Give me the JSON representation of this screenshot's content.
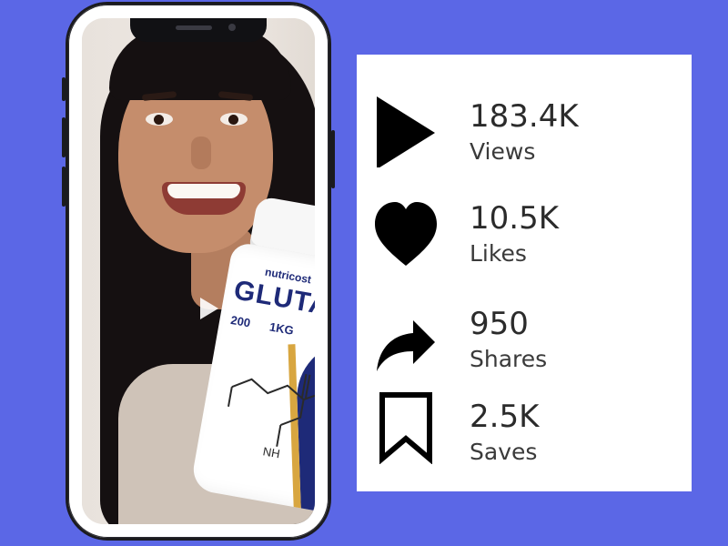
{
  "video": {
    "product": {
      "brand": "nutricost",
      "name": "GLUTAMINE",
      "meta_1": "200",
      "meta_2": "1KG",
      "amine_label": "NH"
    }
  },
  "stats": [
    {
      "icon": "play-icon",
      "value": "183.4K",
      "label": "Views"
    },
    {
      "icon": "heart-icon",
      "value": "10.5K",
      "label": "Likes"
    },
    {
      "icon": "share-icon",
      "value": "950",
      "label": "Shares"
    },
    {
      "icon": "bookmark-icon",
      "value": "2.5K",
      "label": "Saves"
    }
  ],
  "colors": {
    "background": "#5b67e6",
    "card": "#ffffff",
    "icon": "#000000",
    "text": "#2b2b2b"
  }
}
